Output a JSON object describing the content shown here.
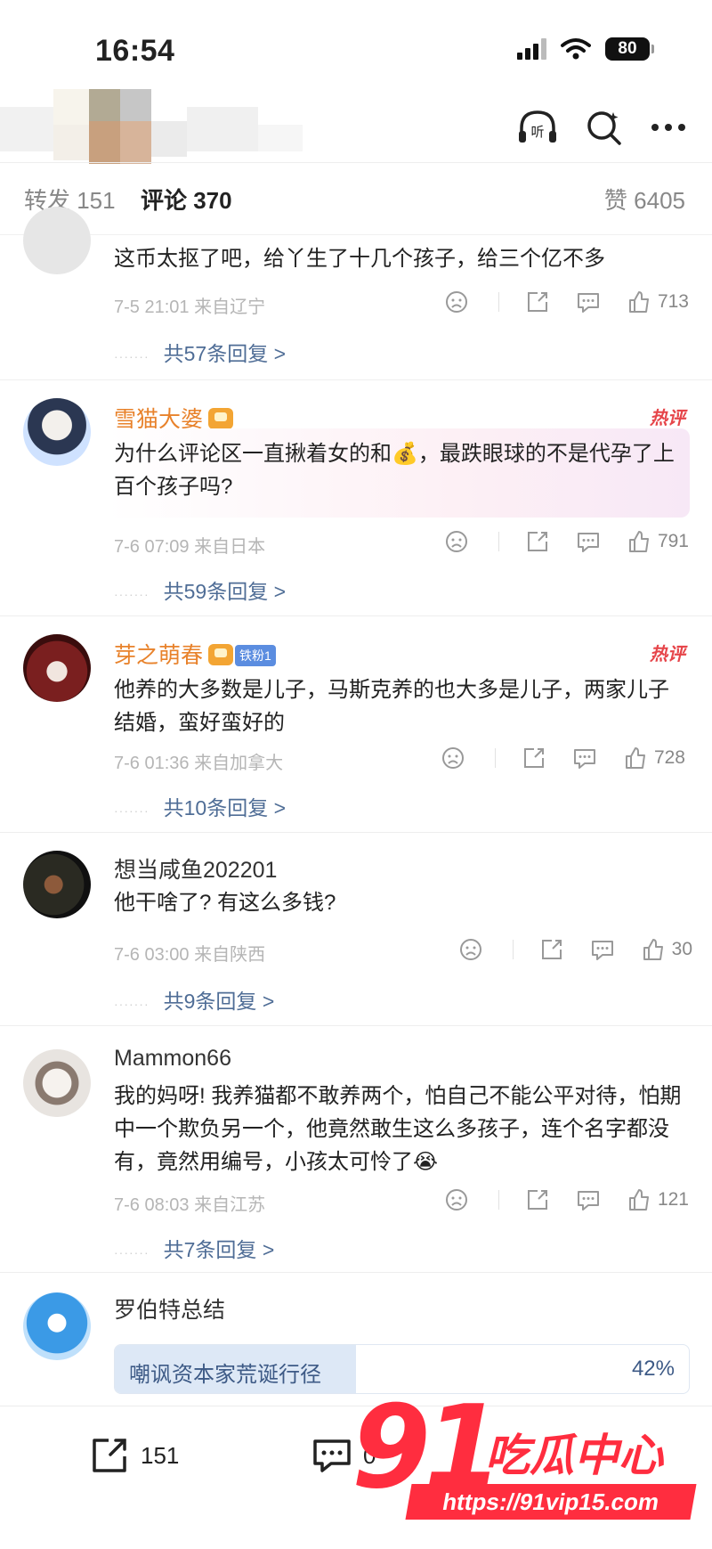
{
  "status": {
    "time": "16:54",
    "battery": "80"
  },
  "tabs": {
    "repost": "转发 151",
    "comment": "评论 370",
    "like": "赞 6405"
  },
  "comments": [
    {
      "text": "这币太抠了吧，给丫生了十几个孩子，给三个亿不多",
      "meta": "7-5 21:01 来自辽宁",
      "likes": "713",
      "replies": "共57条回复 >"
    },
    {
      "name": "雪猫大婆",
      "hot": "热评",
      "text": "为什么评论区一直揪着女的和💰，最跌眼球的不是代孕了上百个孩子吗?",
      "meta": "7-6 07:09 来自日本",
      "likes": "791",
      "replies": "共59条回复 >"
    },
    {
      "name": "芽之萌春",
      "fan_badge": "铁粉1",
      "hot": "热评",
      "text": "他养的大多数是儿子，马斯克养的也大多是儿子，两家儿子结婚，蛮好蛮好的",
      "meta": "7-6 01:36 来自加拿大",
      "likes": "728",
      "replies": "共10条回复 >"
    },
    {
      "name": "想当咸鱼202201",
      "text": "他干啥了? 有这么多钱?",
      "meta": "7-6 03:00 来自陕西",
      "likes": "30",
      "replies": "共9条回复 >"
    },
    {
      "name": "Mammon66",
      "text": "我的妈呀! 我养猫都不敢养两个，怕自己不能公平对待，怕期中一个欺负另一个，他竟然敢生这么多孩子，连个名字都没有，竟然用编号，小孩太可怜了😭",
      "meta": "7-6 08:03 来自江苏",
      "likes": "121",
      "replies": "共7条回复 >"
    }
  ],
  "summary": {
    "name": "罗伯特总结",
    "option": "嘲讽资本家荒诞行径",
    "percent": "42%",
    "percent_value": 42
  },
  "bottom": {
    "repost_count": "151",
    "comment_count": "0"
  },
  "watermark": {
    "number": "91",
    "brand": "吃瓜中心",
    "url": "https://91vip15.com"
  },
  "icons": [
    "signal-icon",
    "wifi-icon",
    "battery-icon",
    "listen-icon",
    "search-icon",
    "more-icon",
    "dislike-icon",
    "share-icon",
    "comment-icon",
    "like-icon"
  ],
  "colors": {
    "hot": "#e6454a",
    "username_hot": "#e8822b",
    "replies_link": "#4f6d96",
    "watermark": "#ff2d3f"
  }
}
